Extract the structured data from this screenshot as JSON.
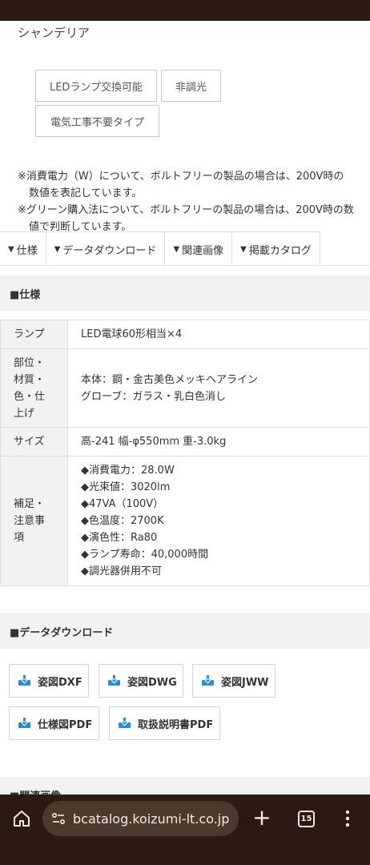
{
  "product": {
    "category": "シャンデリア",
    "tags": [
      "LEDランプ交換可能",
      "非調光",
      "電気工事不要タイプ"
    ],
    "notes": [
      "※消費電力（W）について、ボルトフリーの製品の場合は、200V時の数値を表記しています。",
      "※グリーン購入法について、ボルトフリーの製品の場合は、200V時の数値で判断しています。"
    ]
  },
  "tabs": [
    {
      "icon": "▼",
      "label": "仕様"
    },
    {
      "icon": "▼",
      "label": "データダウンロード"
    },
    {
      "icon": "▼",
      "label": "関連画像"
    },
    {
      "icon": "▼",
      "label": "掲載カタログ"
    }
  ],
  "spec": {
    "heading": "■仕様",
    "rows": [
      {
        "label": "ランプ",
        "values": [
          "LED電球60形相当×4"
        ]
      },
      {
        "label": "部位・材質・色・仕上げ",
        "values": [
          "本体：鋼・金古美色メッキヘアライン",
          "グローブ：ガラス・乳白色消し"
        ]
      },
      {
        "label": "サイズ",
        "values": [
          "高-241 幅-φ550mm 重-3.0kg"
        ]
      },
      {
        "label": "補足・注意事項",
        "values": [
          "◆消費電力：28.0W",
          "◆光束値：3020lm",
          "◆47VA（100V）",
          "◆色温度：2700K",
          "◆演色性：Ra80",
          "◆ランプ寿命：40,000時間",
          "◆調光器併用不可"
        ]
      }
    ]
  },
  "download": {
    "heading": "■データダウンロード",
    "buttons": [
      "姿図DXF",
      "姿図DWG",
      "姿図JWW",
      "仕様図PDF",
      "取扱説明書PDF"
    ],
    "icon": "download-icon",
    "icon_color": "#2a8fd0"
  },
  "related": {
    "heading": "■関連画像"
  },
  "browser": {
    "url": "bcatalog.koizumi-lt.co.jp",
    "tab_count": "15",
    "bar_color": "#2b1a12",
    "pill_color": "#4b3a2e",
    "icons": [
      "home-icon",
      "site-settings-icon",
      "new-tab-icon",
      "tab-switcher-icon",
      "menu-icon"
    ]
  }
}
